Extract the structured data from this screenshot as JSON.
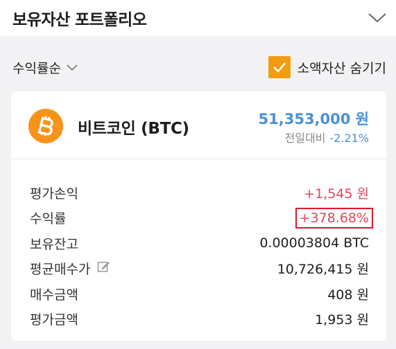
{
  "header": {
    "title": "보유자산 포트폴리오"
  },
  "filters": {
    "sort_label": "수익률순",
    "hide_small_label": "소액자산 숨기기",
    "hide_small_checked": true
  },
  "asset": {
    "name": "비트코인 (BTC)",
    "price": "51,353,000 원",
    "change_label": "전일대비",
    "change_value": "-2.21%",
    "rows": [
      {
        "label": "평가손익",
        "value": "+1,545 원"
      },
      {
        "label": "수익률",
        "value": "+378.68%"
      },
      {
        "label": "보유잔고",
        "value": "0.00003804 BTC"
      },
      {
        "label": "평균매수가",
        "value": "10,726,415 원"
      },
      {
        "label": "매수금액",
        "value": "408 원"
      },
      {
        "label": "평가금액",
        "value": "1,953 원"
      }
    ]
  },
  "colors": {
    "accent_orange": "#f39c12",
    "bitcoin": "#f7931a",
    "price_blue": "#4a90d9",
    "gain_red": "#e0455a",
    "highlight_border": "#d6192b"
  },
  "icons": {
    "header_toggle": "chevron-down-icon",
    "sort_dropdown": "chevron-down-icon",
    "checkbox": "check-icon",
    "coin": "bitcoin-icon",
    "edit": "edit-icon"
  }
}
